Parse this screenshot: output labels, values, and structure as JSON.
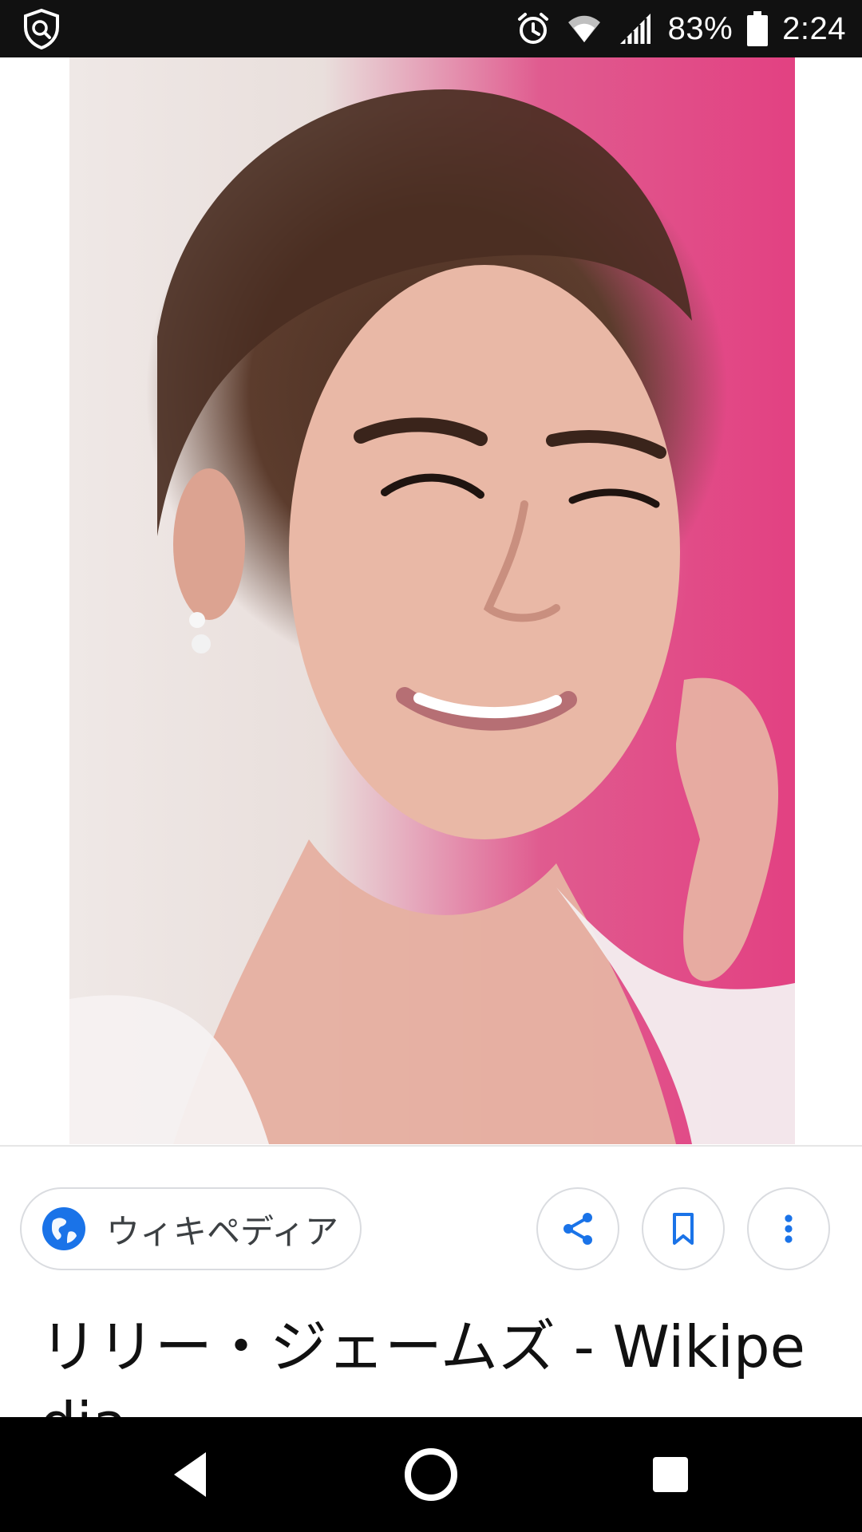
{
  "status_bar": {
    "battery_percent": "83%",
    "time": "2:24",
    "icons": [
      "shield-search-icon",
      "alarm-icon",
      "wifi-icon",
      "signal-icon",
      "battery-icon"
    ]
  },
  "result": {
    "source_label": "ウィキペディア",
    "title": "リリー・ジェームズ - Wikipedia"
  },
  "actions": [
    "share-icon",
    "bookmark-icon",
    "more-vert-icon"
  ],
  "nav": [
    "back-icon",
    "home-icon",
    "recents-icon"
  ],
  "colors": {
    "accent": "#1a73e8",
    "status_bar_bg": "#111111",
    "nav_bar_bg": "#000000"
  }
}
